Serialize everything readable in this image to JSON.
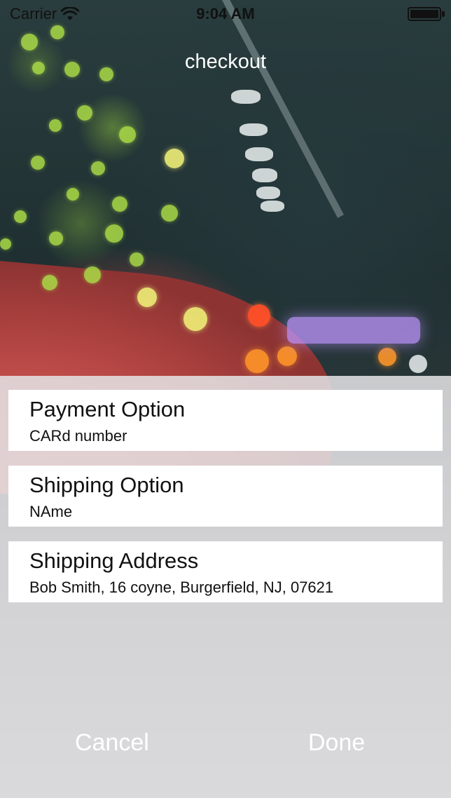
{
  "status_bar": {
    "carrier": "Carrier",
    "wifi_icon": "wifi-icon",
    "time": "9:04 AM",
    "battery_icon": "battery-icon",
    "battery_level": 1.0
  },
  "navigation": {
    "title": "checkout"
  },
  "checkout_options": [
    {
      "title": "Payment Option",
      "value": "CARd number"
    },
    {
      "title": "Shipping Option",
      "value": "NAme"
    },
    {
      "title": "Shipping Address",
      "value": "Bob Smith, 16 coyne, Burgerfield, NJ, 07621"
    }
  ],
  "actions": {
    "cancel_label": "Cancel",
    "done_label": "Done"
  },
  "colors": {
    "panel_background": "#e4e4e6",
    "row_background": "#ffffff",
    "button_text": "#ffffff",
    "umbrella_red": "#c5504d"
  }
}
